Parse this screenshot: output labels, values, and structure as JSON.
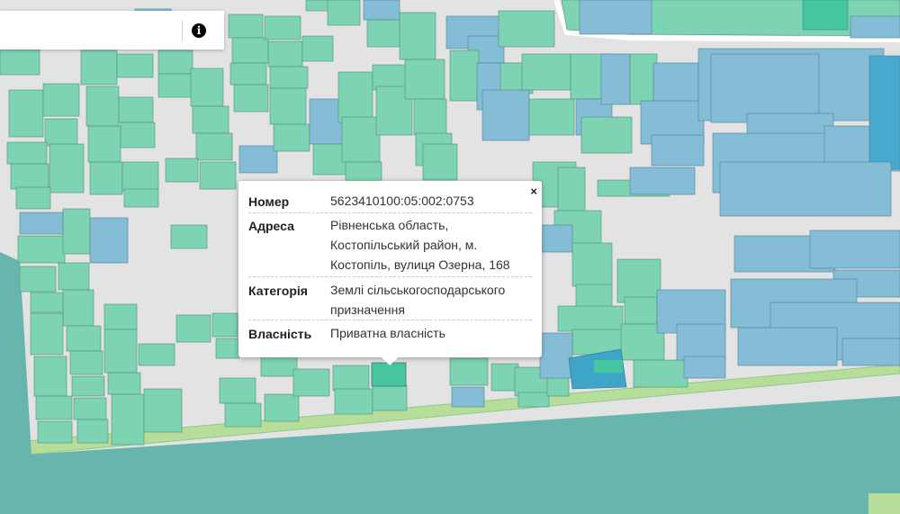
{
  "colors": {
    "background": "#e3e3e3",
    "parcel_green": "#7ed3b2",
    "parcel_blue": "#86bdd6",
    "parcel_teal": "#45c6a0",
    "parcel_dark_blue": "#4aa9cf",
    "water_area": "#67b5ac",
    "strip": "#b7dd9a",
    "road": "#ffffff"
  },
  "toolbar": {
    "info_icon": "i"
  },
  "popup": {
    "close_label": "×",
    "rows": [
      {
        "label": "Номер",
        "value_lines": [
          "5623410100:05:002:0753"
        ]
      },
      {
        "label": "Адреса",
        "value_lines": [
          "Рівненська область,",
          "Костопільський район, м.",
          "Костопіль, вулиця Озерна, 168"
        ]
      },
      {
        "label": "Категорія",
        "value_lines": [
          "Землі сільськогосподарського",
          "призначення"
        ]
      },
      {
        "label": "Власність",
        "value_lines": [
          "Приватна власність"
        ]
      }
    ]
  }
}
